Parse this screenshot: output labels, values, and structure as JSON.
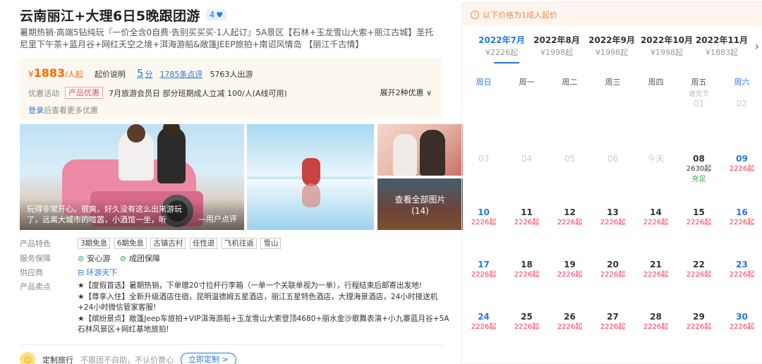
{
  "product": {
    "title": "云南丽江+大理6日5晚跟团游",
    "badge_num": "4",
    "subtitle": "暑期热销·高端5钻纯玩『一价全含0自费·告别买买买·1人起订』5A景区【石林+玉龙雪山大索+丽江古城】圣托尼里下午茶+蓝月谷+网红天空之境+洱海游船&敞篷JEEP旅拍+南诏风情岛 【丽江千古情】"
  },
  "price": {
    "yen": "¥",
    "amount": "1883",
    "unit": "/人起",
    "explain": "起价说明",
    "score": "5",
    "score_unit": "分",
    "reviews": "1785条点评",
    "sold": "5763人出游"
  },
  "promo": {
    "label": "优惠活动",
    "tag": "产品优惠",
    "text": "7月旅游会员日 部分班期成人立减 100/人(A线可用)",
    "expand": "展开2种优惠 ∨",
    "login": "登录",
    "login_rest": "后查看更多优惠"
  },
  "gallery": {
    "quote": "玩得非常开心。很爽，好久没有这么出来游玩了，远离大城市的喧嚣，小酒馆一坐，听",
    "quote_src": "—用户点评",
    "view_all": "查看全部图片",
    "view_all_count": "(14)"
  },
  "features": {
    "tags_label": "产品特色",
    "tags": [
      "3期免息",
      "6期免息",
      "古镇古村",
      "任性退",
      "飞机往返",
      "雪山"
    ],
    "guarantee_label": "服务保障",
    "guarantees": [
      "安心游",
      "成团保障"
    ],
    "supplier_label": "供应商",
    "supplier": "环游天下",
    "selling_label": "产品卖点",
    "selling_points": [
      "★【度假首选】暑期热销，下单赠20寸拉杆行李箱（一单一个关联单视为一单），行程结束后邮寄出发地!",
      "★【尊享入住】全新升级酒店住宿，昆明温德姆五星酒店，丽江五星特色酒店，大理海景酒店，24小时接送机+24小时微信管家客服!",
      "★【缤纷景点】敞篷Jeep车旅拍+VIP洱海游船+玉龙雪山大索登顶4680+丽水金沙歌舞表演+小九寨蓝月谷+5A石林风景区+网红基地旅拍!"
    ]
  },
  "bottom": {
    "text": "定制旅行",
    "note": "不跟团不自助，不认价费心",
    "button": "立即定制 >"
  },
  "calendar": {
    "notice": "以下价格为1成人起价",
    "months": [
      {
        "name": "2022年7月",
        "price": "¥2226起"
      },
      {
        "name": "2022年8月",
        "price": "¥1998起"
      },
      {
        "name": "2022年9月",
        "price": "¥1998起"
      },
      {
        "name": "2022年10月",
        "price": "¥1998起"
      },
      {
        "name": "2022年11月",
        "price": "¥1883起"
      }
    ],
    "weekdays": [
      "周日",
      "周一",
      "周二",
      "周三",
      "周四",
      "周五",
      "周六"
    ],
    "holiday_label": "建党节",
    "rows": [
      [
        {
          "d": ""
        },
        {
          "d": ""
        },
        {
          "d": ""
        },
        {
          "d": ""
        },
        {
          "d": ""
        },
        {
          "d": "01",
          "h": "建党节",
          "past": true
        },
        {
          "d": "02",
          "past": true
        }
      ],
      [
        {
          "d": "03",
          "past": true
        },
        {
          "d": "04",
          "past": true
        },
        {
          "d": "05",
          "past": true
        },
        {
          "d": "06",
          "past": true
        },
        {
          "d": "今天",
          "past": true
        },
        {
          "d": "08",
          "p": "2630起",
          "s": "充足"
        },
        {
          "d": "09",
          "p": "2226起"
        }
      ],
      [
        {
          "d": "10",
          "p": "2226起"
        },
        {
          "d": "11",
          "p": "2226起"
        },
        {
          "d": "12",
          "p": "2226起"
        },
        {
          "d": "13",
          "p": "2226起"
        },
        {
          "d": "14",
          "p": "2226起"
        },
        {
          "d": "15",
          "p": "2226起"
        },
        {
          "d": "16",
          "p": "2226起"
        }
      ],
      [
        {
          "d": "17",
          "p": "2226起"
        },
        {
          "d": "18",
          "p": "2226起"
        },
        {
          "d": "19",
          "p": "2226起"
        },
        {
          "d": "20",
          "p": "2226起"
        },
        {
          "d": "21",
          "p": "2226起"
        },
        {
          "d": "22",
          "p": "2226起"
        },
        {
          "d": "23",
          "p": "2226起"
        }
      ],
      [
        {
          "d": "24",
          "p": "2226起"
        },
        {
          "d": "25",
          "p": "2226起"
        },
        {
          "d": "26",
          "p": "2226起"
        },
        {
          "d": "27",
          "p": "2226起"
        },
        {
          "d": "28",
          "p": "2226起"
        },
        {
          "d": "29",
          "p": "2226起"
        },
        {
          "d": "30",
          "p": "2226起"
        }
      ]
    ]
  }
}
